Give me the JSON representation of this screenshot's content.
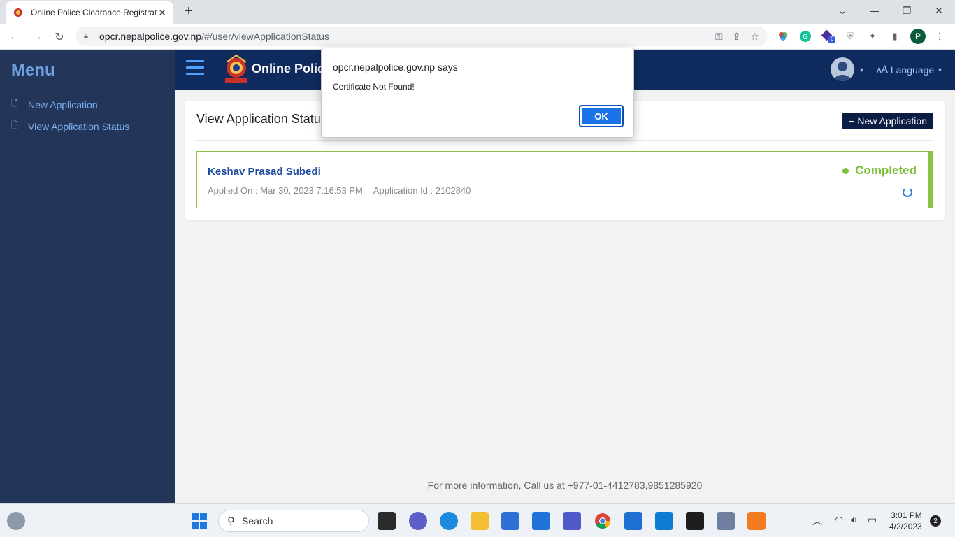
{
  "browser": {
    "tab_title": "Online Police Clearance Registrat",
    "tab_close": "✕",
    "new_tab": "+",
    "url_host": "opcr.nepalpolice.gov.np",
    "url_path": "/#/user/viewApplicationStatus",
    "profile_initial": "P",
    "ext_badge": "6"
  },
  "sidebar": {
    "title": "Menu",
    "items": [
      {
        "label": "New Application"
      },
      {
        "label": "View Application Status"
      }
    ]
  },
  "header": {
    "brand": "Online Polic",
    "language": "Language"
  },
  "main": {
    "title": "View Application Statu",
    "new_button": "+ New Application",
    "application": {
      "name": "Keshav Prasad Subedi",
      "applied_on": "Applied On : Mar 30, 2023 7:16:53 PM",
      "application_id": "Application Id : 2102840",
      "status": "Completed"
    }
  },
  "footer": {
    "text": "For more information, Call us at +977-01-4412783,9851285920"
  },
  "dialog": {
    "title": "opcr.nepalpolice.gov.np says",
    "message": "Certificate Not Found!",
    "ok": "OK"
  },
  "taskbar": {
    "search": "Search",
    "time": "3:01 PM",
    "date": "4/2/2023",
    "notifications": "2"
  },
  "colors": {
    "sidebar_bg": "#24355a",
    "header_bg": "#0f2a5c",
    "status_green": "#7cbf3a",
    "ok_blue": "#1a73e8"
  }
}
